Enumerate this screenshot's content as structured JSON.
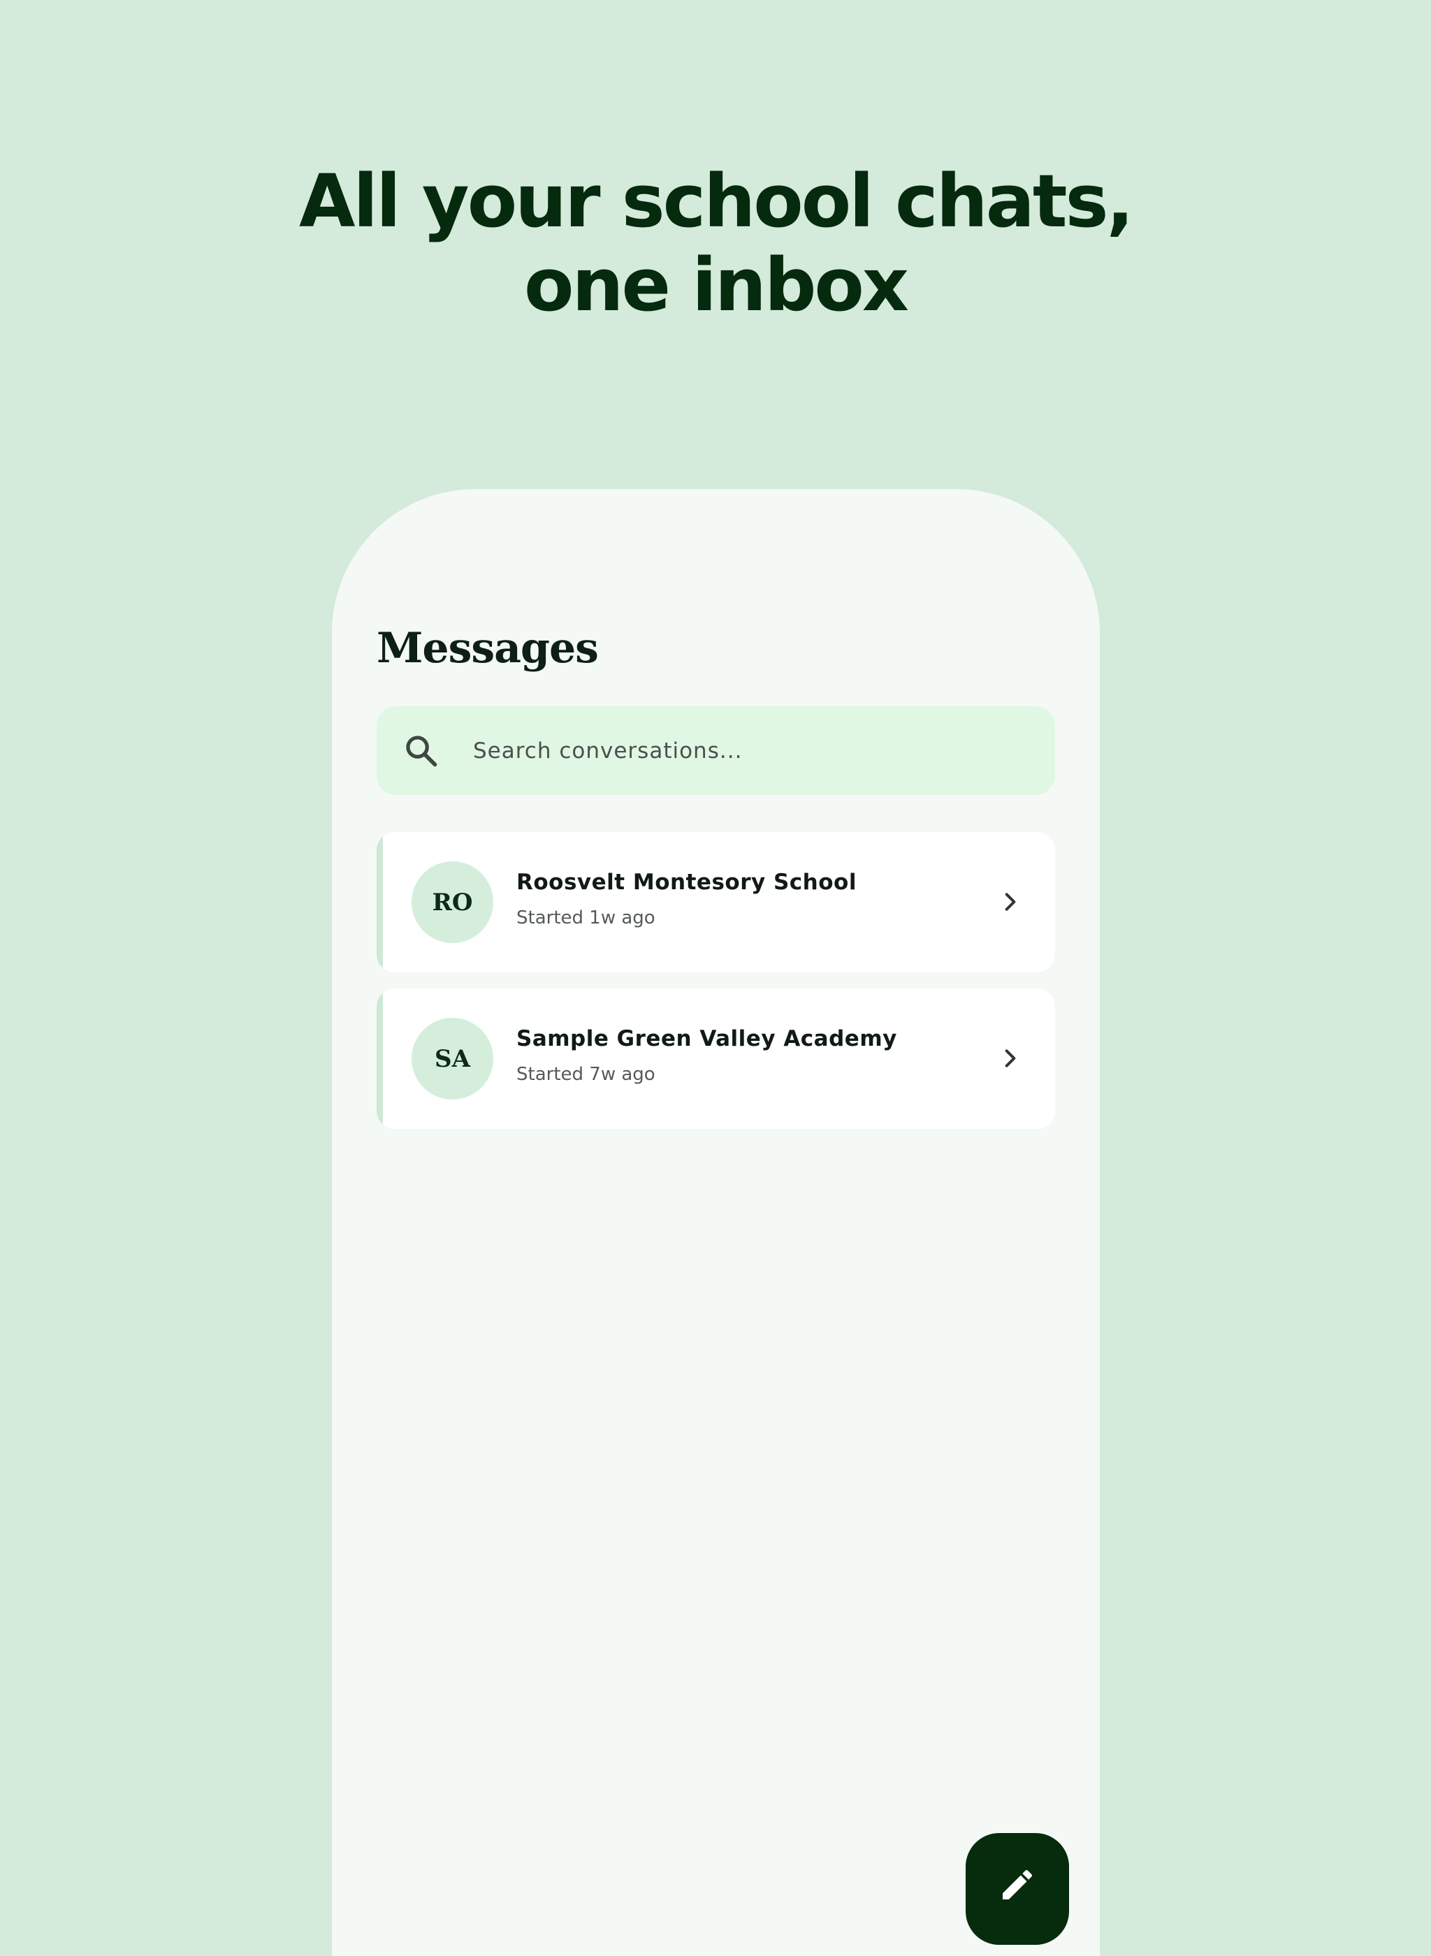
{
  "headline": {
    "line1": "All your school chats,",
    "line2": "one inbox"
  },
  "screen": {
    "title": "Messages",
    "search": {
      "placeholder": "Search conversations...",
      "value": "",
      "icon": "search-icon"
    },
    "conversations": [
      {
        "initials": "RO",
        "name": "Roosvelt Montesory School",
        "subtitle": "Started 1w ago",
        "icon": "chevron-right-icon"
      },
      {
        "initials": "SA",
        "name": "Sample Green Valley Academy",
        "subtitle": "Started 7w ago",
        "icon": "chevron-right-icon"
      }
    ],
    "fab": {
      "icon": "pencil-icon"
    }
  },
  "colors": {
    "background": "#d4eadb",
    "phone": "#f4f9f5",
    "search_bg": "#e0f7e4",
    "avatar_bg": "#d4eedb",
    "dark_green": "#062b0d"
  }
}
